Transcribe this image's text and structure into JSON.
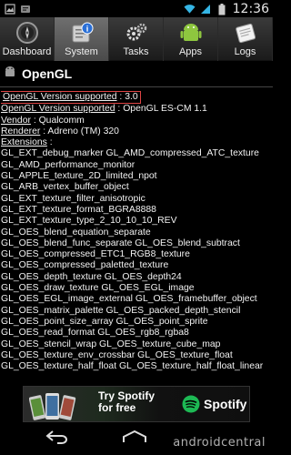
{
  "status_bar": {
    "time": "12:36"
  },
  "tabs": [
    {
      "label": "Dashboard",
      "icon": "compass-icon"
    },
    {
      "label": "System",
      "icon": "info-icon"
    },
    {
      "label": "Tasks",
      "icon": "gears-icon"
    },
    {
      "label": "Apps",
      "icon": "android-icon"
    },
    {
      "label": "Logs",
      "icon": "notepad-icon"
    }
  ],
  "section": {
    "title": "OpenGL"
  },
  "rows": [
    {
      "key": "OpenGL Version supported",
      "value": " : 3.0"
    },
    {
      "key": "OpenGL Version supported",
      "value": " : OpenGL ES-CM 1.1"
    },
    {
      "key": "Vendor",
      "value": " : Qualcomm"
    },
    {
      "key": "Renderer",
      "value": " : Adreno (TM) 320"
    },
    {
      "key": "Extensions",
      "value": " :"
    },
    {
      "key": "",
      "value": "GL_EXT_debug_marker GL_AMD_compressed_ATC_texture"
    },
    {
      "key": "",
      "value": "GL_AMD_performance_monitor"
    },
    {
      "key": "",
      "value": "GL_APPLE_texture_2D_limited_npot"
    },
    {
      "key": "",
      "value": "GL_ARB_vertex_buffer_object"
    },
    {
      "key": "",
      "value": "GL_EXT_texture_filter_anisotropic"
    },
    {
      "key": "",
      "value": "GL_EXT_texture_format_BGRA8888"
    },
    {
      "key": "",
      "value": "GL_EXT_texture_type_2_10_10_10_REV"
    },
    {
      "key": "",
      "value": "GL_OES_blend_equation_separate"
    },
    {
      "key": "",
      "value": "GL_OES_blend_func_separate GL_OES_blend_subtract"
    },
    {
      "key": "",
      "value": "GL_OES_compressed_ETC1_RGB8_texture"
    },
    {
      "key": "",
      "value": "GL_OES_compressed_paletted_texture"
    },
    {
      "key": "",
      "value": "GL_OES_depth_texture GL_OES_depth24"
    },
    {
      "key": "",
      "value": "GL_OES_draw_texture GL_OES_EGL_image"
    },
    {
      "key": "",
      "value": "GL_OES_EGL_image_external GL_OES_framebuffer_object"
    },
    {
      "key": "",
      "value": "GL_OES_matrix_palette GL_OES_packed_depth_stencil"
    },
    {
      "key": "",
      "value": "GL_OES_point_size_array GL_OES_point_sprite"
    },
    {
      "key": "",
      "value": "GL_OES_read_format GL_OES_rgb8_rgba8"
    },
    {
      "key": "",
      "value": "GL_OES_stencil_wrap GL_OES_texture_cube_map"
    },
    {
      "key": "",
      "value": "GL_OES_texture_env_crossbar GL_OES_texture_float"
    },
    {
      "key": "",
      "value": "GL_OES_texture_half_float GL_OES_texture_half_float_linear"
    }
  ],
  "ad": {
    "line1": "Try Spotify",
    "line2": "for free",
    "brand": "Spotify"
  },
  "watermark": "androidcentral",
  "colors": {
    "highlight_border": "#d44444",
    "tab_active": "#5d5d5d",
    "spotify_green": "#1db954"
  }
}
